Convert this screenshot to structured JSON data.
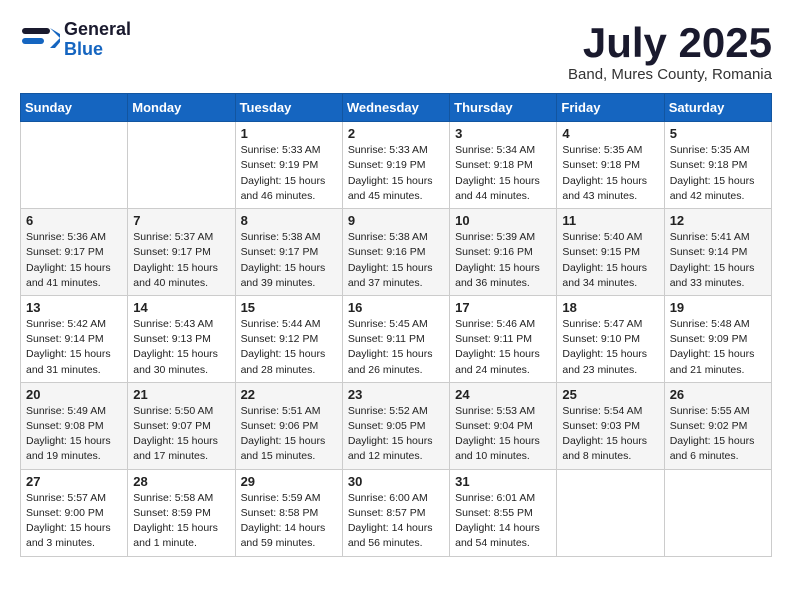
{
  "logo": {
    "general": "General",
    "blue": "Blue"
  },
  "title": "July 2025",
  "subtitle": "Band, Mures County, Romania",
  "headers": [
    "Sunday",
    "Monday",
    "Tuesday",
    "Wednesday",
    "Thursday",
    "Friday",
    "Saturday"
  ],
  "weeks": [
    [
      {
        "day": "",
        "info": ""
      },
      {
        "day": "",
        "info": ""
      },
      {
        "day": "1",
        "info": "Sunrise: 5:33 AM\nSunset: 9:19 PM\nDaylight: 15 hours and 46 minutes."
      },
      {
        "day": "2",
        "info": "Sunrise: 5:33 AM\nSunset: 9:19 PM\nDaylight: 15 hours and 45 minutes."
      },
      {
        "day": "3",
        "info": "Sunrise: 5:34 AM\nSunset: 9:18 PM\nDaylight: 15 hours and 44 minutes."
      },
      {
        "day": "4",
        "info": "Sunrise: 5:35 AM\nSunset: 9:18 PM\nDaylight: 15 hours and 43 minutes."
      },
      {
        "day": "5",
        "info": "Sunrise: 5:35 AM\nSunset: 9:18 PM\nDaylight: 15 hours and 42 minutes."
      }
    ],
    [
      {
        "day": "6",
        "info": "Sunrise: 5:36 AM\nSunset: 9:17 PM\nDaylight: 15 hours and 41 minutes."
      },
      {
        "day": "7",
        "info": "Sunrise: 5:37 AM\nSunset: 9:17 PM\nDaylight: 15 hours and 40 minutes."
      },
      {
        "day": "8",
        "info": "Sunrise: 5:38 AM\nSunset: 9:17 PM\nDaylight: 15 hours and 39 minutes."
      },
      {
        "day": "9",
        "info": "Sunrise: 5:38 AM\nSunset: 9:16 PM\nDaylight: 15 hours and 37 minutes."
      },
      {
        "day": "10",
        "info": "Sunrise: 5:39 AM\nSunset: 9:16 PM\nDaylight: 15 hours and 36 minutes."
      },
      {
        "day": "11",
        "info": "Sunrise: 5:40 AM\nSunset: 9:15 PM\nDaylight: 15 hours and 34 minutes."
      },
      {
        "day": "12",
        "info": "Sunrise: 5:41 AM\nSunset: 9:14 PM\nDaylight: 15 hours and 33 minutes."
      }
    ],
    [
      {
        "day": "13",
        "info": "Sunrise: 5:42 AM\nSunset: 9:14 PM\nDaylight: 15 hours and 31 minutes."
      },
      {
        "day": "14",
        "info": "Sunrise: 5:43 AM\nSunset: 9:13 PM\nDaylight: 15 hours and 30 minutes."
      },
      {
        "day": "15",
        "info": "Sunrise: 5:44 AM\nSunset: 9:12 PM\nDaylight: 15 hours and 28 minutes."
      },
      {
        "day": "16",
        "info": "Sunrise: 5:45 AM\nSunset: 9:11 PM\nDaylight: 15 hours and 26 minutes."
      },
      {
        "day": "17",
        "info": "Sunrise: 5:46 AM\nSunset: 9:11 PM\nDaylight: 15 hours and 24 minutes."
      },
      {
        "day": "18",
        "info": "Sunrise: 5:47 AM\nSunset: 9:10 PM\nDaylight: 15 hours and 23 minutes."
      },
      {
        "day": "19",
        "info": "Sunrise: 5:48 AM\nSunset: 9:09 PM\nDaylight: 15 hours and 21 minutes."
      }
    ],
    [
      {
        "day": "20",
        "info": "Sunrise: 5:49 AM\nSunset: 9:08 PM\nDaylight: 15 hours and 19 minutes."
      },
      {
        "day": "21",
        "info": "Sunrise: 5:50 AM\nSunset: 9:07 PM\nDaylight: 15 hours and 17 minutes."
      },
      {
        "day": "22",
        "info": "Sunrise: 5:51 AM\nSunset: 9:06 PM\nDaylight: 15 hours and 15 minutes."
      },
      {
        "day": "23",
        "info": "Sunrise: 5:52 AM\nSunset: 9:05 PM\nDaylight: 15 hours and 12 minutes."
      },
      {
        "day": "24",
        "info": "Sunrise: 5:53 AM\nSunset: 9:04 PM\nDaylight: 15 hours and 10 minutes."
      },
      {
        "day": "25",
        "info": "Sunrise: 5:54 AM\nSunset: 9:03 PM\nDaylight: 15 hours and 8 minutes."
      },
      {
        "day": "26",
        "info": "Sunrise: 5:55 AM\nSunset: 9:02 PM\nDaylight: 15 hours and 6 minutes."
      }
    ],
    [
      {
        "day": "27",
        "info": "Sunrise: 5:57 AM\nSunset: 9:00 PM\nDaylight: 15 hours and 3 minutes."
      },
      {
        "day": "28",
        "info": "Sunrise: 5:58 AM\nSunset: 8:59 PM\nDaylight: 15 hours and 1 minute."
      },
      {
        "day": "29",
        "info": "Sunrise: 5:59 AM\nSunset: 8:58 PM\nDaylight: 14 hours and 59 minutes."
      },
      {
        "day": "30",
        "info": "Sunrise: 6:00 AM\nSunset: 8:57 PM\nDaylight: 14 hours and 56 minutes."
      },
      {
        "day": "31",
        "info": "Sunrise: 6:01 AM\nSunset: 8:55 PM\nDaylight: 14 hours and 54 minutes."
      },
      {
        "day": "",
        "info": ""
      },
      {
        "day": "",
        "info": ""
      }
    ]
  ]
}
